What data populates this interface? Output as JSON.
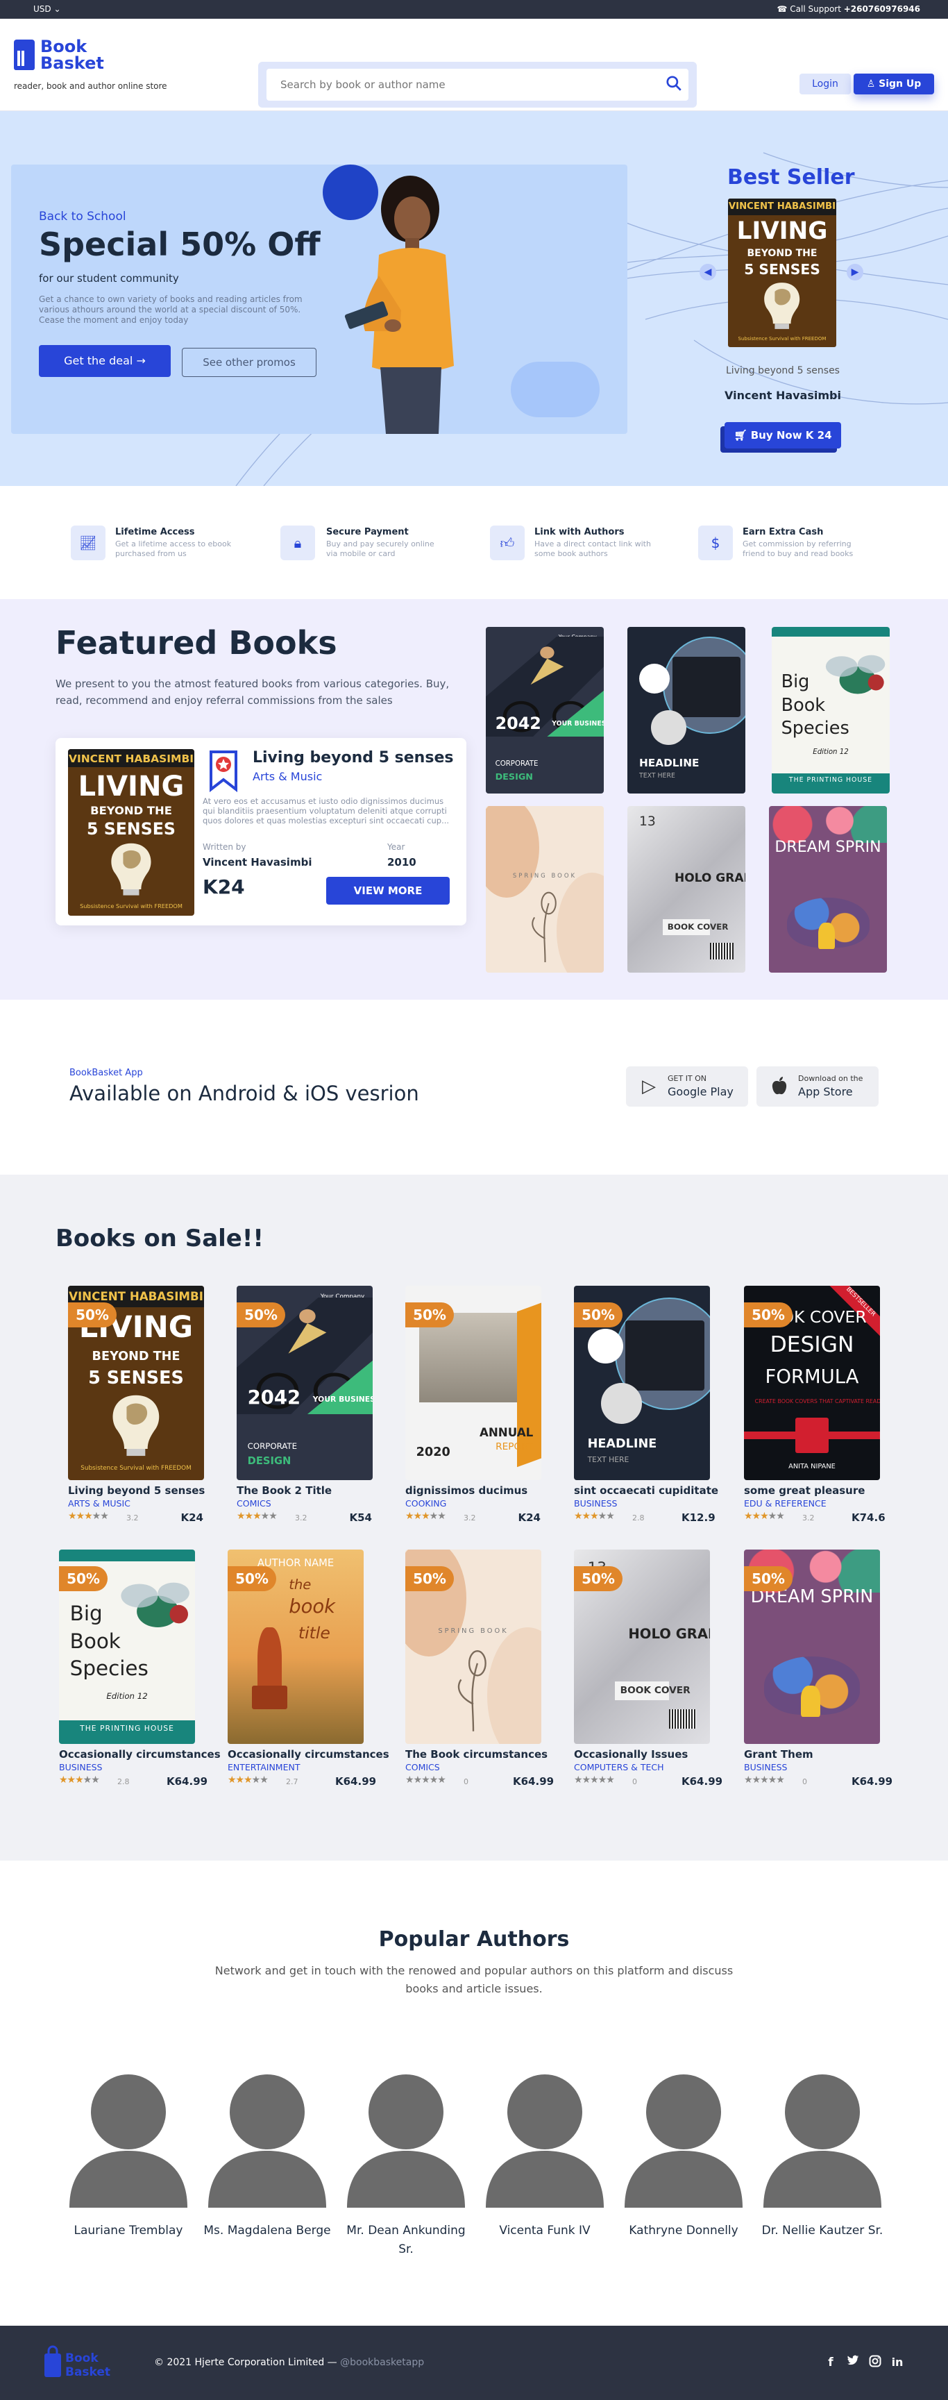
{
  "topbar": {
    "currency": "USD",
    "support_label": "Call Support",
    "support_phone": "+260760976946"
  },
  "header": {
    "logo_line1": "Book",
    "logo_line2": "Basket",
    "tagline": "reader, book and author online store",
    "search_placeholder": "Search by book or author name",
    "login": "Login",
    "signup": "Sign Up"
  },
  "hero": {
    "promo_subtitle": "Back to School",
    "promo_title": "Special 50% Off",
    "promo_community": "for our student community",
    "promo_desc": "Get a chance to own variety of books and reading articles from various athours around the world at a special discount of 50%. Cease the moment and enjoy today",
    "cta_deal": "Get the deal",
    "cta_promos": "See other promos",
    "best_seller_title": "Best Seller",
    "best_book_name": "Living beyond 5 senses",
    "best_book_author": "Vincent Havasimbi",
    "buy_label": "Buy Now K 24"
  },
  "features": [
    {
      "icon": "chart-icon",
      "title": "Lifetime Access",
      "desc": "Get a lifetime access to ebook purchased from us"
    },
    {
      "icon": "lock-icon",
      "title": "Secure Payment",
      "desc": "Buy and pay securely online via mobile or card"
    },
    {
      "icon": "thumbs-up-icon",
      "title": "Link with Authors",
      "desc": "Have a direct contact link with some book authors"
    },
    {
      "icon": "dollar-icon",
      "title": "Earn Extra Cash",
      "desc": "Get commission by referring friend to buy and read books"
    }
  ],
  "featured": {
    "title": "Featured Books",
    "desc": "We present to you the atmost featured books from various categories. Buy, read, recommend and enjoy referral commissions from the sales",
    "card": {
      "title": "Living beyond 5 senses",
      "category": "Arts & Music",
      "desc": "At vero eos et accusamus et iusto odio dignissimos ducimus qui blanditiis praesentium voluptatum deleniti atque corrupti quos dolores et quas molestias excepturi sint occaecati cup...",
      "written_by_label": "Written by",
      "author": "Vincent Havasimbi",
      "year_label": "Year",
      "year": "2010",
      "price": "K24",
      "cta": "VIEW MORE"
    }
  },
  "covers": {
    "living": {
      "top": "VINCENT HABASIMBI",
      "line1": "LIVING",
      "line2": "BEYOND THE",
      "line3": "5 SENSES",
      "foot": "Subsistence Survival with FREEDOM"
    },
    "book2": {
      "brand": "Your Company",
      "year": "2042",
      "tag": "YOUR BUSINESS NAME",
      "foot1": "CORPORATE",
      "foot2": "DESIGN"
    },
    "headline": {
      "title": "HEADLINE",
      "sub": "TEXT HERE"
    },
    "spring": {
      "text": "SPRING BOOK"
    },
    "holo": {
      "num": "13",
      "title": "HOLO GRAPHIC+",
      "sub": "BOOK COVER"
    },
    "dream": {
      "title": "DREAM SPRIN"
    },
    "annual": {
      "year": "2020",
      "title": "ANNUAL",
      "sub": "REPORT"
    },
    "design": {
      "title1": "BOOK COVER",
      "title2": "DESIGN",
      "title3": "FORMULA",
      "sub": "CREATE BOOK COVERS THAT CAPTIVATE READERS",
      "author": "ANITA NIPANE",
      "ribbon": "BESTSELLER"
    },
    "bigbook": {
      "line1": "Big",
      "line2": "Book",
      "line3": "Species",
      "ed": "Edition 12",
      "foot": "THE PRINTING HOUSE"
    },
    "booktitle": {
      "author": "AUTHOR NAME",
      "title1": "the",
      "title2": "book",
      "title3": "title"
    }
  },
  "app": {
    "tag": "BookBasket App",
    "title": "Available on Android & iOS vesrion",
    "gp_small": "GET IT ON",
    "gp_big": "Google Play",
    "as_small": "Download on the",
    "as_big": "App Store"
  },
  "sale": {
    "title": "Books on Sale!!",
    "discount": "50%",
    "books": [
      {
        "name": "Living beyond 5 senses",
        "category": "ARTS & MUSIC",
        "rating": "3.2",
        "price": "K24"
      },
      {
        "name": "The Book 2 Title",
        "category": "COMICS",
        "rating": "3.2",
        "price": "K54"
      },
      {
        "name": "dignissimos ducimus",
        "category": "COOKING",
        "rating": "3.2",
        "price": "K24"
      },
      {
        "name": "sint occaecati cupiditate",
        "category": "BUSINESS",
        "rating": "2.8",
        "price": "K12.9"
      },
      {
        "name": "some great pleasure",
        "category": "EDU & REFERENCE",
        "rating": "3.2",
        "price": "K74.6"
      },
      {
        "name": "Occasionally circumstances",
        "category": "BUSINESS",
        "rating": "2.8",
        "price": "K64.99"
      },
      {
        "name": "Occasionally circumstances",
        "category": "ENTERTAINMENT",
        "rating": "2.7",
        "price": "K64.99"
      },
      {
        "name": "The Book circumstances",
        "category": "COMICS",
        "rating": "0",
        "price": "K64.99"
      },
      {
        "name": "Occasionally Issues",
        "category": "COMPUTERS & TECH",
        "rating": "0",
        "price": "K64.99"
      },
      {
        "name": "Grant Them",
        "category": "BUSINESS",
        "rating": "0",
        "price": "K64.99"
      }
    ]
  },
  "authors": {
    "title": "Popular Authors",
    "desc": "Network and get in touch with the renowed and popular authors on this platform and discuss books and article issues.",
    "list": [
      "Lauriane Tremblay",
      "Ms. Magdalena Berge",
      "Mr. Dean Ankunding Sr.",
      "Vicenta Funk IV",
      "Kathryne Donnelly",
      "Dr. Nellie Kautzer Sr."
    ]
  },
  "footer": {
    "copyright": "© 2021 Hjerte Corporation Limited —",
    "handle": "@bookbasketapp"
  },
  "colors": {
    "primary": "#2845d8",
    "dark": "#2d3342",
    "accent": "#e0862a"
  }
}
